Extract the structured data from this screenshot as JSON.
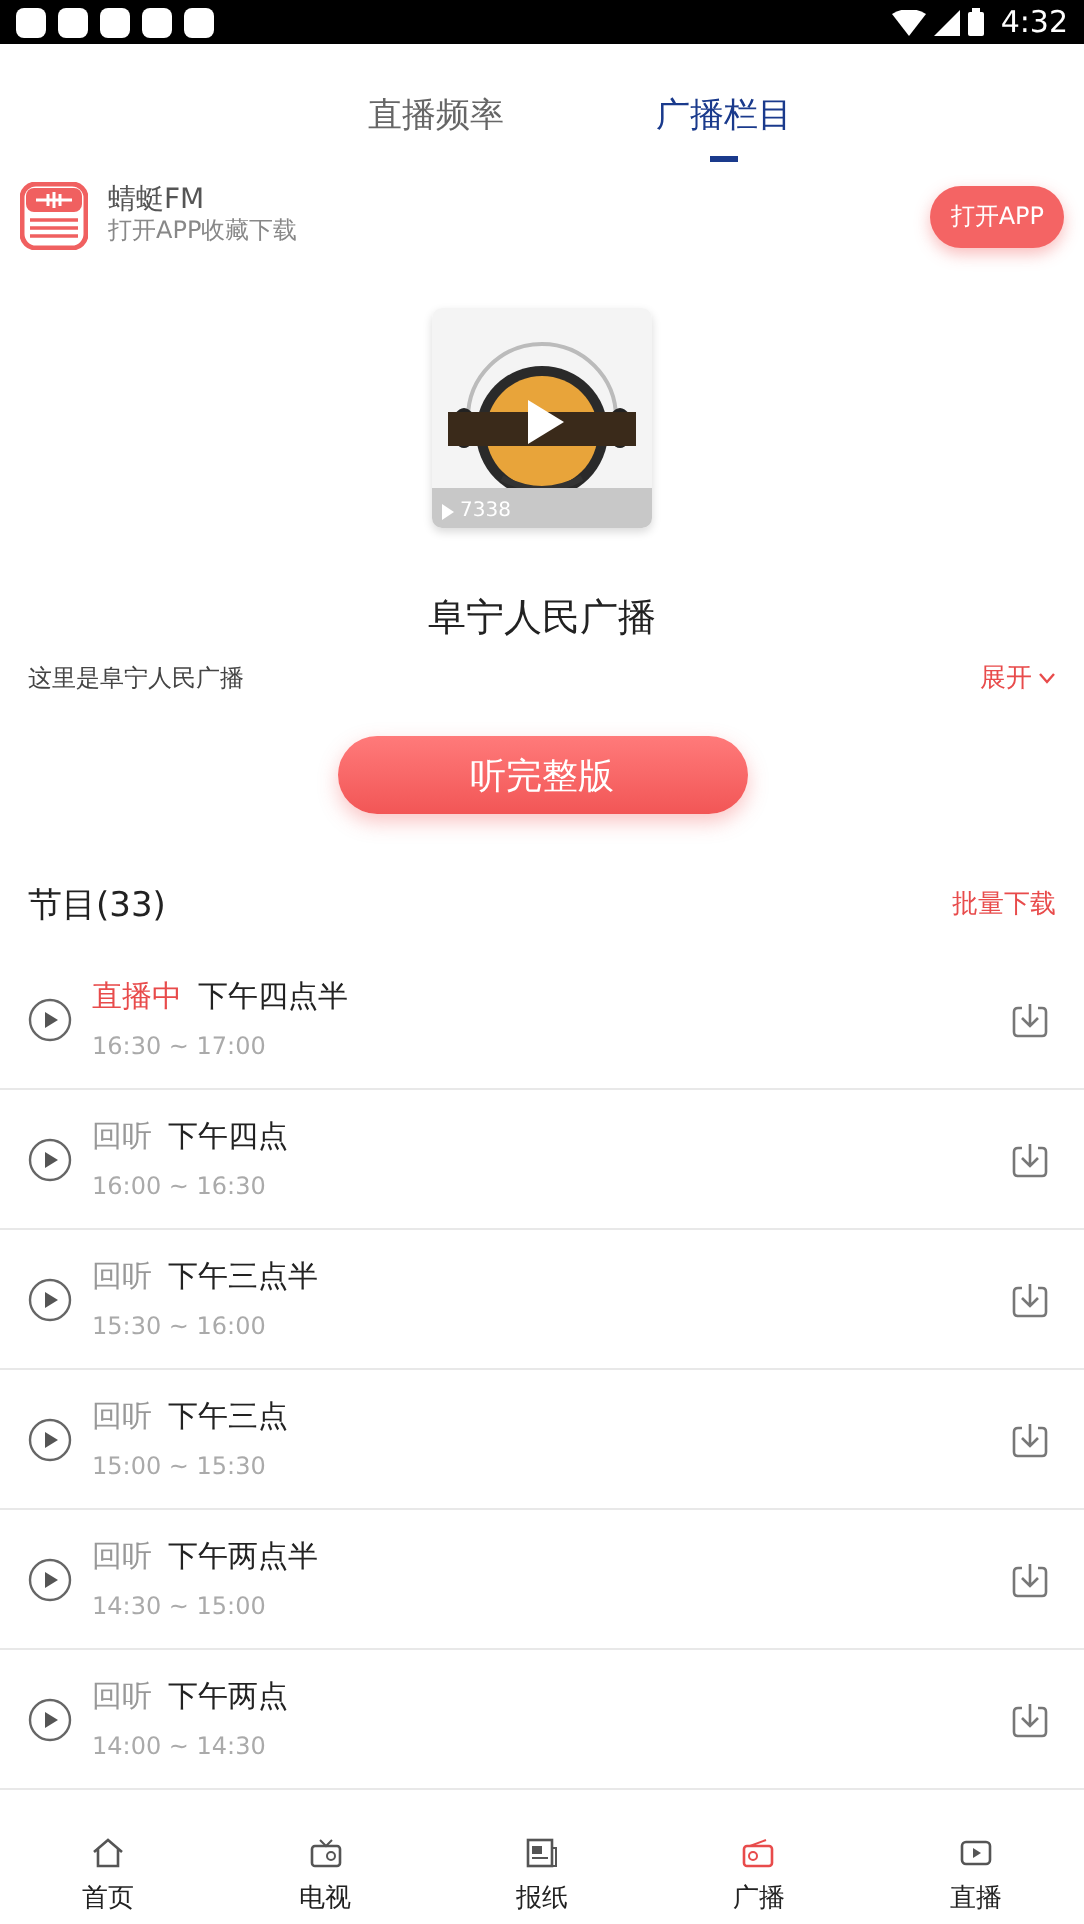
{
  "status_bar": {
    "time": "4:32"
  },
  "tabs": [
    {
      "label": "直播频率",
      "selected": false
    },
    {
      "label": "广播栏目",
      "selected": true
    }
  ],
  "banner": {
    "app_name": "蜻蜓FM",
    "subtitle": "打开APP收藏下载",
    "button": "打开APP"
  },
  "cover": {
    "kind": "picture",
    "play_count": "7338"
  },
  "station": {
    "title": "阜宁人民广播",
    "description": "这里是阜宁人民广播",
    "expand": "展开"
  },
  "listen_button": "听完整版",
  "programs_header": {
    "title": "节目(33)",
    "batch_download": "批量下载"
  },
  "programs": [
    {
      "kind": "live",
      "status": "直播中",
      "title": "下午四点半",
      "time": "16:30 ~ 17:00"
    },
    {
      "kind": "replay",
      "status": "回听",
      "title": "下午四点",
      "time": "16:00 ~ 16:30"
    },
    {
      "kind": "replay",
      "status": "回听",
      "title": "下午三点半",
      "time": "15:30 ~ 16:00"
    },
    {
      "kind": "replay",
      "status": "回听",
      "title": "下午三点",
      "time": "15:00 ~ 15:30"
    },
    {
      "kind": "replay",
      "status": "回听",
      "title": "下午两点半",
      "time": "14:30 ~ 15:00"
    },
    {
      "kind": "replay",
      "status": "回听",
      "title": "下午两点",
      "time": "14:00 ~ 14:30"
    }
  ],
  "bottom_nav": [
    {
      "label": "首页",
      "kind": "home",
      "selected": false
    },
    {
      "label": "电视",
      "kind": "tv",
      "selected": false
    },
    {
      "label": "报纸",
      "kind": "newspaper",
      "selected": false
    },
    {
      "label": "广播",
      "kind": "radio",
      "selected": true
    },
    {
      "label": "直播",
      "kind": "live",
      "selected": false
    }
  ]
}
